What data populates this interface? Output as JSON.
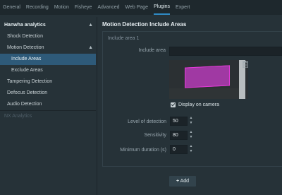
{
  "tabs": [
    "General",
    "Recording",
    "Motion",
    "Fisheye",
    "Advanced",
    "Web Page",
    "Plugins",
    "Expert"
  ],
  "active_tab_index": 6,
  "sidebar": {
    "header": "Hanwha analytics",
    "shock": "Shock Detection",
    "motion": "Motion Detection",
    "include": "Include Areas",
    "exclude": "Exclude Areas",
    "tampering": "Tampering Detection",
    "defocus": "Defocus Detection",
    "audio": "Audio Detection",
    "nx": "NX Analytics"
  },
  "panel": {
    "title": "Motion Detection Include Areas",
    "group": "Include area 1",
    "include_area_label": "Include area",
    "display_on_camera": "Display on camera",
    "level_label": "Level of detection",
    "level_value": "50",
    "sensitivity_label": "Sensitivity",
    "sensitivity_value": "80",
    "min_duration_label": "Minimum duration (s)",
    "min_duration_value": "0",
    "add_label": "Add"
  }
}
